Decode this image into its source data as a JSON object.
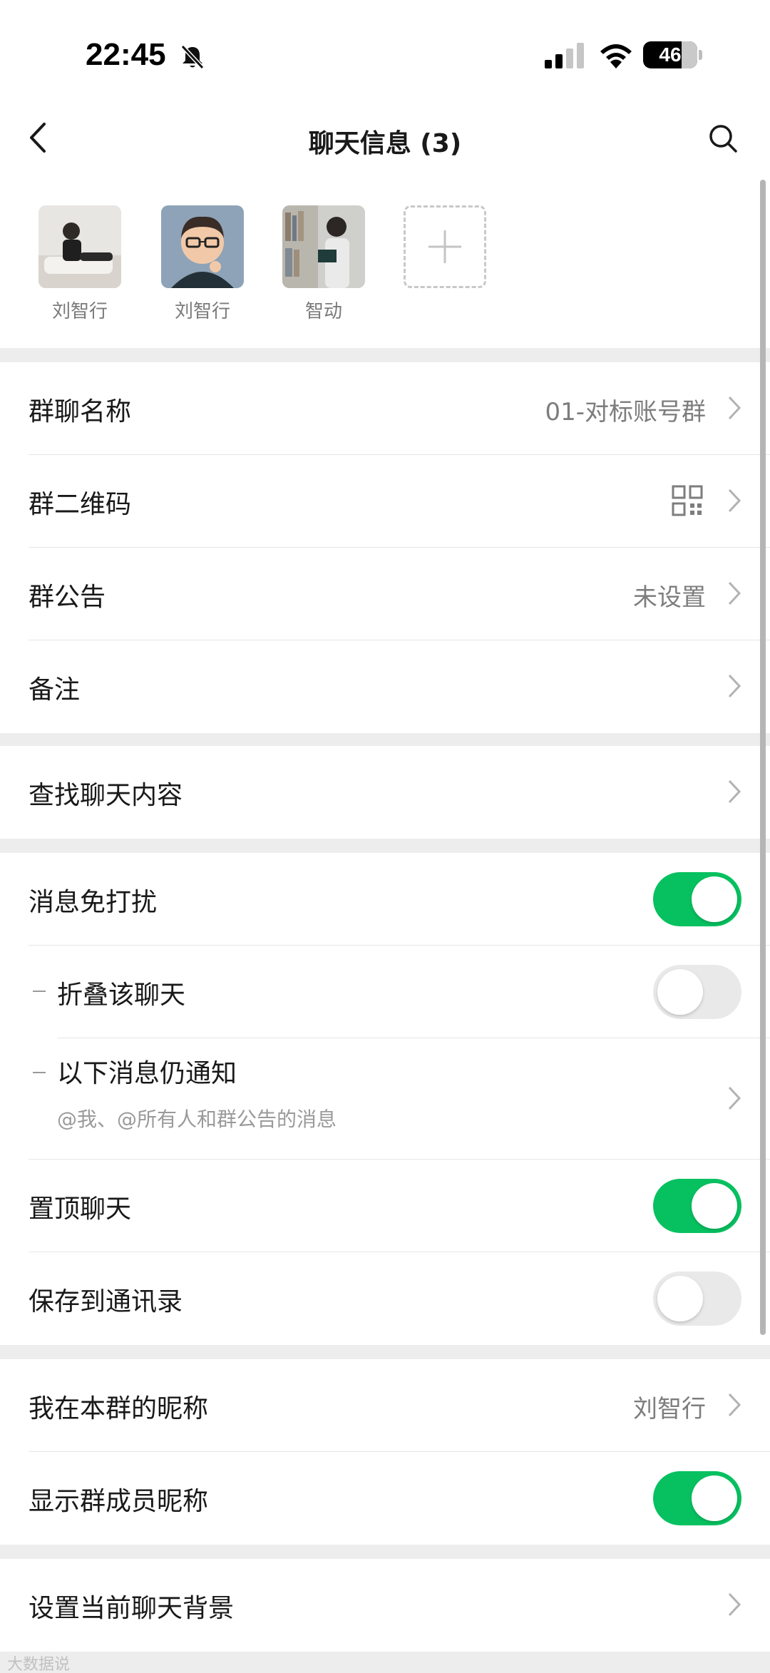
{
  "status_bar": {
    "time": "22:45",
    "battery": "46"
  },
  "nav": {
    "title": "聊天信息 (3)"
  },
  "members": [
    {
      "name": "刘智行"
    },
    {
      "name": "刘智行"
    },
    {
      "name": "智动"
    }
  ],
  "group_info": {
    "name_label": "群聊名称",
    "name_value": "01-对标账号群",
    "qr_label": "群二维码",
    "notice_label": "群公告",
    "notice_value": "未设置",
    "remark_label": "备注"
  },
  "search": {
    "label": "查找聊天内容"
  },
  "settings": {
    "mute": {
      "label": "消息免打扰",
      "on": true
    },
    "fold": {
      "label": "折叠该聊天",
      "on": false
    },
    "still_notify": {
      "label": "以下消息仍通知",
      "sub": "@我、@所有人和群公告的消息"
    },
    "pin": {
      "label": "置顶聊天",
      "on": true
    },
    "save_contacts": {
      "label": "保存到通讯录",
      "on": false
    }
  },
  "nickname": {
    "my_label": "我在本群的昵称",
    "my_value": "刘智行",
    "show_label": "显示群成员昵称",
    "show_on": true
  },
  "background": {
    "label": "设置当前聊天背景"
  },
  "watermark": "大数据说",
  "colors": {
    "accent_green": "#07c160",
    "page_bg": "#ededed"
  }
}
